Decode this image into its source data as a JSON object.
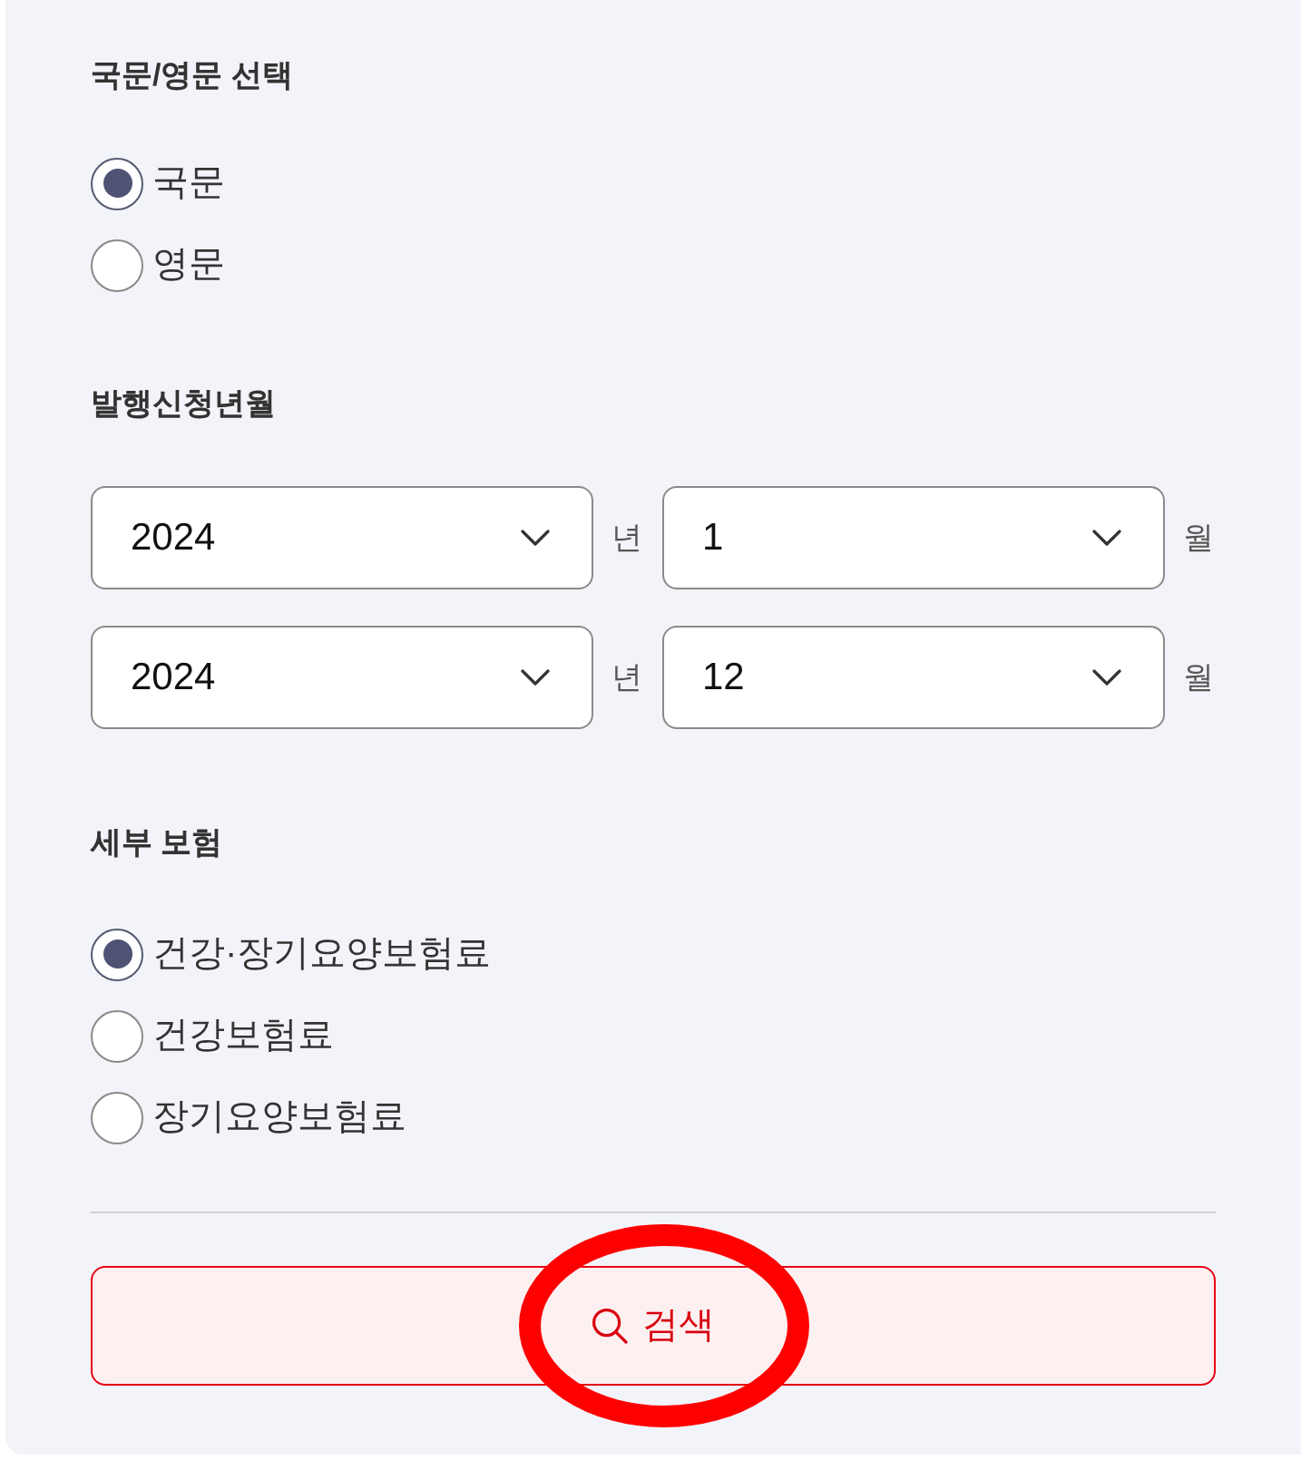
{
  "language_section": {
    "title": "국문/영문 선택",
    "options": [
      {
        "label": "국문",
        "selected": true
      },
      {
        "label": "영문",
        "selected": false
      }
    ]
  },
  "period_section": {
    "title": "발행신청년월",
    "rows": [
      {
        "year": "2024",
        "year_unit": "년",
        "month": "1",
        "month_unit": "월"
      },
      {
        "year": "2024",
        "year_unit": "년",
        "month": "12",
        "month_unit": "월"
      }
    ]
  },
  "insurance_section": {
    "title": "세부 보험",
    "options": [
      {
        "label": "건강·장기요양보험료",
        "selected": true
      },
      {
        "label": "건강보험료",
        "selected": false
      },
      {
        "label": "장기요양보험료",
        "selected": false
      }
    ]
  },
  "search_button": {
    "label": "검색",
    "circled": true
  }
}
